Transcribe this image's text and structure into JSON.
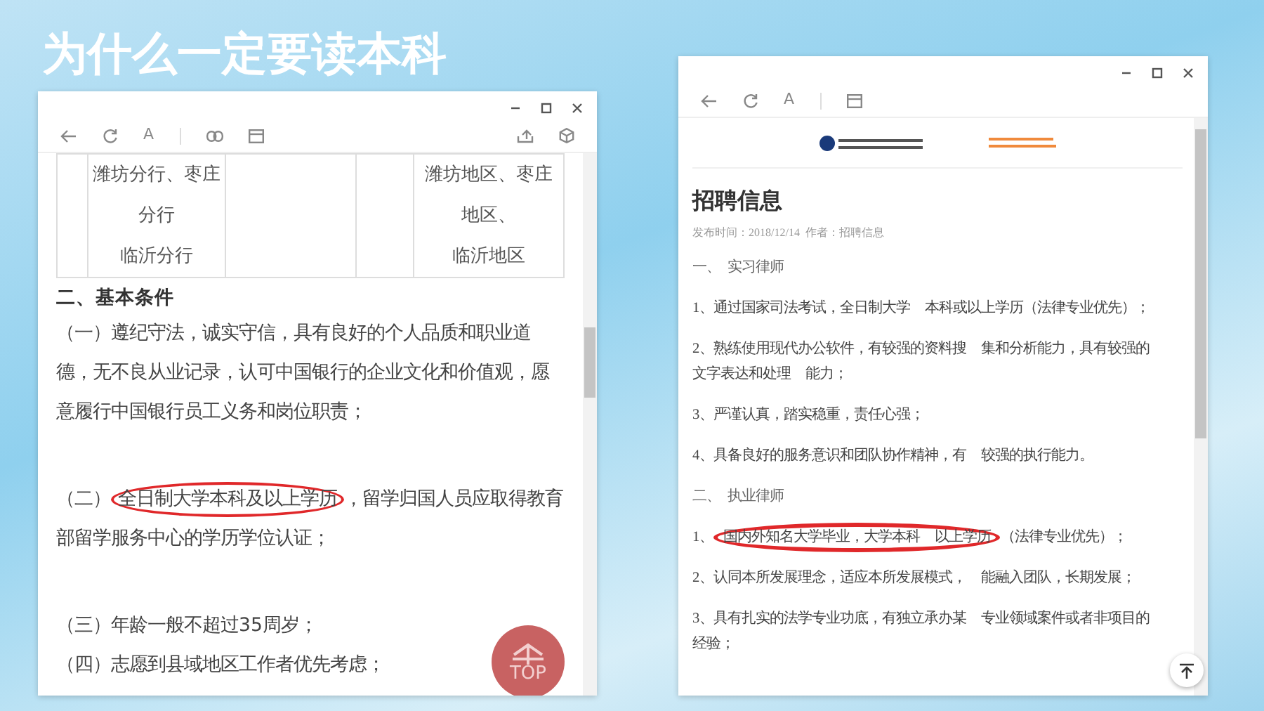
{
  "slide": {
    "title": "为什么一定要读本科"
  },
  "left_window": {
    "toolbar_text": "A",
    "table_row": {
      "column_2": [
        "潍坊分行、枣庄",
        "分行",
        "临沂分行"
      ],
      "column_5": [
        "潍坊地区、枣庄",
        "地区、",
        "临沂地区"
      ]
    },
    "heading": "二、基本条件",
    "paragraphs": [
      {
        "segments": [
          {
            "text": "（一）遵纪守法，诚实守信，具有良好的个人品质和职业道德，无不良从业记录，认可中国银行的企业文化和价值观，愿意履行中国银行员工义务和岗位职责；",
            "circled": false
          }
        ]
      },
      {
        "segments": [
          {
            "text": "（二）",
            "circled": false
          },
          {
            "text": "全日制大学本科及以上学历",
            "circled": true
          },
          {
            "text": "，留学归国人员应取得教育部留学服务中心的学历学位认证；",
            "circled": false
          }
        ]
      },
      {
        "segments": [
          {
            "text": "（三）年龄一般不超过35周岁；",
            "circled": false
          }
        ]
      },
      {
        "segments": [
          {
            "text": "（四）志愿到县域地区工作者优先考虑；",
            "circled": false
          }
        ]
      }
    ],
    "top_button": {
      "label": "TOP"
    }
  },
  "right_window": {
    "toolbar_text": "A",
    "title": "招聘信息",
    "meta": "发布时间：2018/12/14  作者：招聘信息",
    "paragraphs": [
      {
        "kind": "section",
        "segments": [
          {
            "text": "一、  实习律师",
            "circled": false
          }
        ]
      },
      {
        "kind": "item",
        "segments": [
          {
            "text": "1、通过国家司法考试，全日制大学    本科或以上学历（法律专业优先）；",
            "circled": false
          }
        ]
      },
      {
        "kind": "item",
        "segments": [
          {
            "text": "2、熟练使用现代办公软件，有较强的资料搜    集和分析能力，具有较强的文字表达和处理    能力；",
            "circled": false
          }
        ]
      },
      {
        "kind": "item",
        "segments": [
          {
            "text": "3、严谨认真，踏实稳重，责任心强；",
            "circled": false
          }
        ]
      },
      {
        "kind": "item",
        "segments": [
          {
            "text": "4、具备良好的服务意识和团队协作精神，有    较强的执行能力。",
            "circled": false
          }
        ]
      },
      {
        "kind": "section",
        "segments": [
          {
            "text": "二、  执业律师",
            "circled": false
          }
        ]
      },
      {
        "kind": "item",
        "segments": [
          {
            "text": "1、",
            "circled": false
          },
          {
            "text": "国内外知名大学毕业，大学本科    以上学历",
            "circled": true
          },
          {
            "text": "（法律专业优先）；",
            "circled": false
          }
        ]
      },
      {
        "kind": "item",
        "segments": [
          {
            "text": "2、认同本所发展理念，适应本所发展模式，    能融入团队，长期发展；",
            "circled": false
          }
        ]
      },
      {
        "kind": "item",
        "segments": [
          {
            "text": "3、具有扎实的法学专业功底，有独立承办某    专业领域案件或者非项目的经验；",
            "circled": false
          }
        ]
      }
    ]
  }
}
